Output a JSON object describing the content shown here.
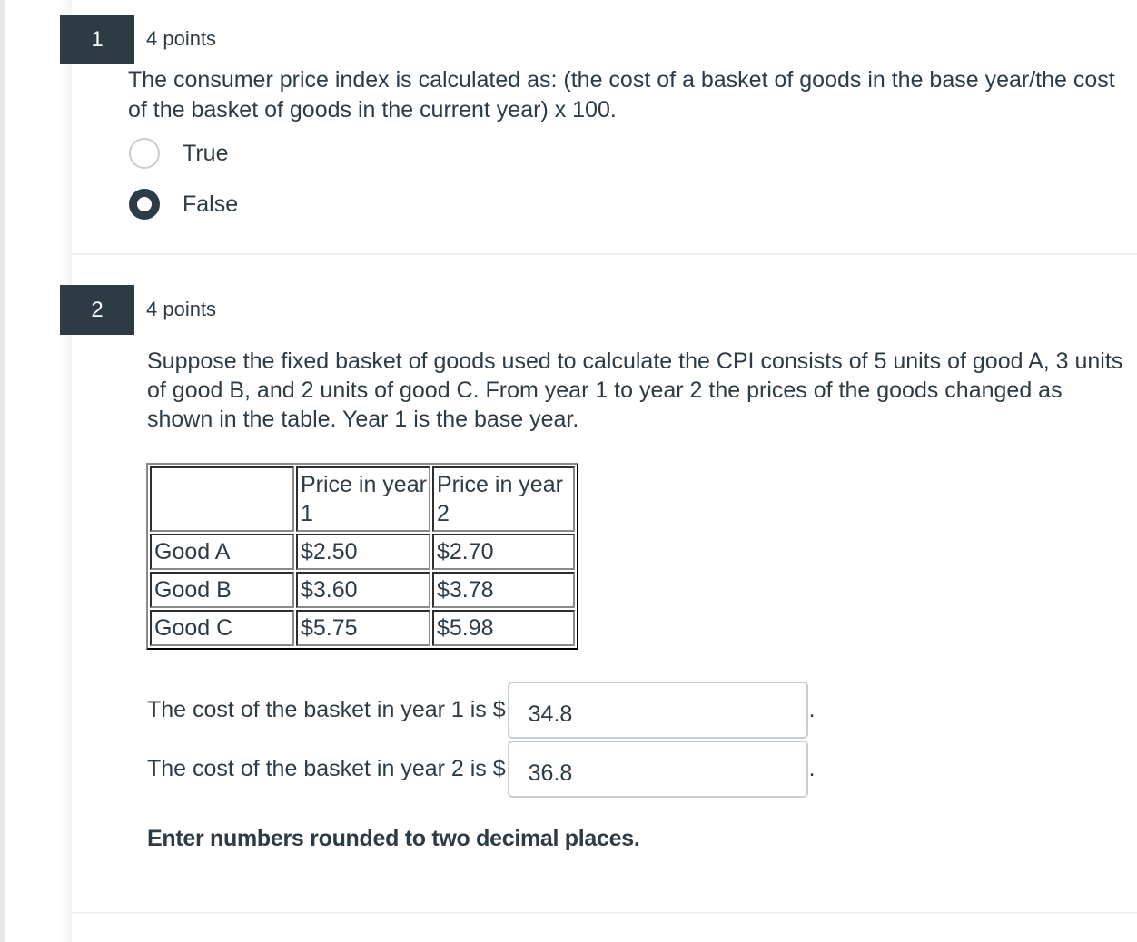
{
  "questions": [
    {
      "number": "1",
      "points": "4 points",
      "prompt": "The consumer price index is calculated as: (the cost of a basket of goods in the base year/the cost of the basket of goods in the current year) x 100.",
      "options": [
        {
          "label": "True",
          "selected": false
        },
        {
          "label": "False",
          "selected": true
        }
      ]
    },
    {
      "number": "2",
      "points": "4 points",
      "prompt": "Suppose the fixed basket of goods used to calculate the CPI consists of 5 units of good A, 3 units of good B, and 2 units of good C. From year 1 to year 2 the prices of the goods changed as shown in the table. Year 1 is the base year.",
      "table": {
        "headers": [
          "",
          "Price in year 1",
          "Price in year 2"
        ],
        "rows": [
          [
            "Good A",
            "$2.50",
            "$2.70"
          ],
          [
            "Good B",
            "$3.60",
            "$3.78"
          ],
          [
            "Good C",
            "$5.75",
            "$5.98"
          ]
        ]
      },
      "answers": [
        {
          "prefix": "The cost of the basket in year 1 is $",
          "value": "34.8",
          "suffix": "."
        },
        {
          "prefix": "The cost of the basket in year 2 is $",
          "value": "36.8",
          "suffix": "."
        }
      ],
      "note": "Enter numbers rounded to two decimal places."
    }
  ]
}
